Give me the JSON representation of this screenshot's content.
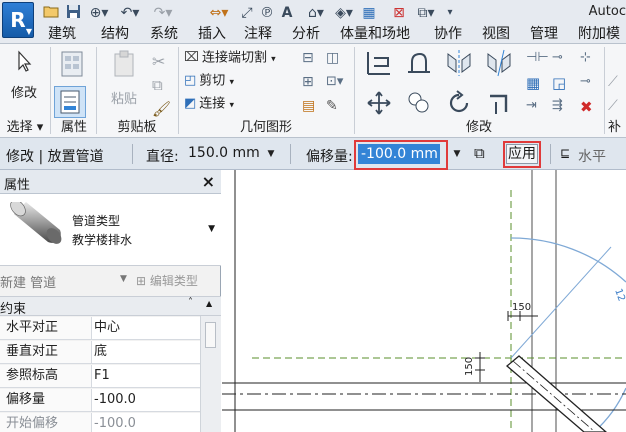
{
  "app": {
    "logo_letter": "R",
    "title_partial": "Autoc"
  },
  "ribbon_tabs": [
    "建筑",
    "结构",
    "系统",
    "插入",
    "注释",
    "分析",
    "体量和场地",
    "协作",
    "视图",
    "管理",
    "附加模"
  ],
  "ribbon": {
    "select": {
      "label": "修改",
      "group": "选择"
    },
    "properties": {
      "group": "属性"
    },
    "clipboard": {
      "paste_label": "粘贴",
      "group": "剪贴板"
    },
    "geometry": {
      "items": [
        "连接端切割",
        "剪切",
        "连接"
      ],
      "group": "几何图形"
    },
    "modify": {
      "group": "修改"
    },
    "next_group_partial": "补"
  },
  "options_bar": {
    "context": "修改 | 放置管道",
    "diameter_label": "直径:",
    "diameter_value": "150.0 mm",
    "offset_label": "偏移量:",
    "offset_value": "-100.0 mm",
    "apply_label": "应用",
    "justify_value": "水平"
  },
  "properties_panel": {
    "title": "属性",
    "type_name": "管道类型",
    "type_value": "教学楼排水",
    "instance_label": "新建 管道",
    "edit_type_label": "编辑类型",
    "category": "约束",
    "rows": [
      {
        "key": "水平对正",
        "value": "中心"
      },
      {
        "key": "垂直对正",
        "value": "底"
      },
      {
        "key": "参照标高",
        "value": "F1"
      },
      {
        "key": "偏移量",
        "value": "-100.0"
      },
      {
        "key": "开始偏移",
        "value": "-100.0"
      }
    ]
  },
  "drawing": {
    "dim_horizontal": "150",
    "dim_vertical": "150",
    "arc_label": "12"
  },
  "colors": {
    "accent": "#3384d6",
    "highlight_box": "#e03a3a",
    "dashed_green": "#5a8f2b",
    "arc_blue": "#7fa9d6"
  }
}
